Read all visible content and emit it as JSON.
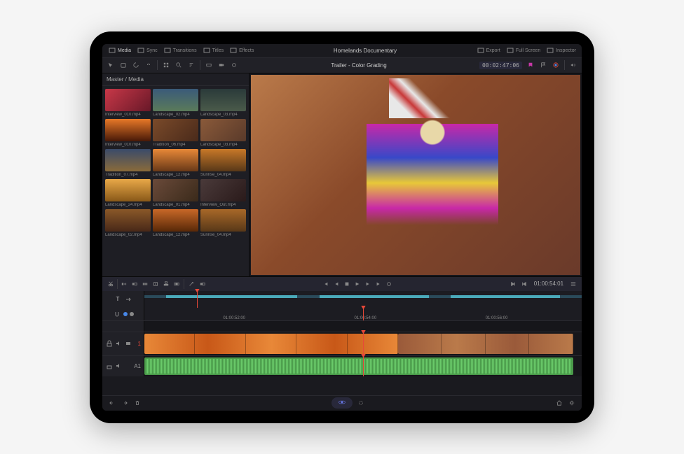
{
  "project_title": "Homelands Documentary",
  "top_tabs": [
    {
      "label": "Media",
      "icon": "media-icon"
    },
    {
      "label": "Sync",
      "icon": "sync-icon"
    },
    {
      "label": "Transitions",
      "icon": "transitions-icon"
    },
    {
      "label": "Titles",
      "icon": "titles-icon"
    },
    {
      "label": "Effects",
      "icon": "effects-icon"
    }
  ],
  "top_right": [
    {
      "label": "Export",
      "icon": "export-icon"
    },
    {
      "label": "Full Screen",
      "icon": "fullscreen-icon"
    },
    {
      "label": "Inspector",
      "icon": "inspector-icon"
    }
  ],
  "viewer": {
    "title": "Trailer - Color Grading",
    "timecode": "00:02:47:06",
    "play_tc": "01:00:54:01"
  },
  "media_pool": {
    "breadcrumb": "Master / Media",
    "clips": [
      {
        "name": "Interview_010.mp4",
        "bg": "linear-gradient(135deg,#c83848,#681828)"
      },
      {
        "name": "Landscape_02.mp4",
        "bg": "linear-gradient(180deg,#3a5a7a,#5a7a5a)"
      },
      {
        "name": "Landscape_03.mp4",
        "bg": "linear-gradient(180deg,#2a3a3a,#4a5a4a)"
      },
      {
        "name": "Interview_010.mp4",
        "bg": "linear-gradient(180deg,#e87828,#481808)"
      },
      {
        "name": "Tradition_06.mp4",
        "bg": "linear-gradient(135deg,#7a4a2a,#4a2a1a)"
      },
      {
        "name": "Landscape_03.mp4",
        "bg": "linear-gradient(135deg,#8a5a3a,#5a3a2a)"
      },
      {
        "name": "Tradition_07.mp4",
        "bg": "linear-gradient(180deg,#3a4a6a,#8a6a3a)"
      },
      {
        "name": "Landscape_12.mp4",
        "bg": "linear-gradient(180deg,#e88838,#683818)"
      },
      {
        "name": "Sunrise_04.mp4",
        "bg": "linear-gradient(180deg,#c87828,#583818)"
      },
      {
        "name": "Landscape_24.mp4",
        "bg": "linear-gradient(180deg,#e8a848,#885818)"
      },
      {
        "name": "Landscape_01.mp4",
        "bg": "linear-gradient(135deg,#6a4a3a,#3a2a1a)"
      },
      {
        "name": "Interview_Out.mp4",
        "bg": "linear-gradient(135deg,#4a3a3a,#2a1a1a)"
      },
      {
        "name": "Landscape_02.mp4",
        "bg": "linear-gradient(180deg,#8a5828,#482818)"
      },
      {
        "name": "Landscape_12.mp4",
        "bg": "linear-gradient(180deg,#c86828,#582808)"
      },
      {
        "name": "Sunrise_04.mp4",
        "bg": "linear-gradient(180deg,#a86828,#583818)"
      }
    ]
  },
  "timeline": {
    "ruler_labels": [
      "01:00:52:00",
      "01:00:54:00",
      "01:00:56:00"
    ],
    "video_track": {
      "label": "1"
    },
    "audio_track": {
      "label": "A1"
    }
  }
}
